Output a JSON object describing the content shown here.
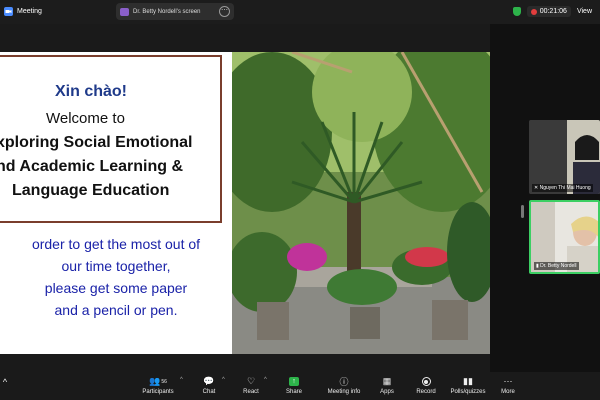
{
  "window": {
    "app_title": "Meeting"
  },
  "share_pill": {
    "label": "Dr. Betty Nordell's screen"
  },
  "top_right": {
    "timer": "00:21:06",
    "view_label": "View"
  },
  "slide": {
    "greeting": "Xin chào!",
    "welcome": "Welcome to",
    "title_line1": "xploring  Social Emotional",
    "title_line2": "nd Academic Learning  &",
    "title_line3": "Language Education",
    "instructions": [
      "order to get the most out of",
      "our time together,",
      "please get some paper",
      "and a pencil or pen."
    ]
  },
  "participants_gallery": [
    {
      "name": "Nguyen Thi Mai Huong"
    },
    {
      "name": "Dr. Betty Nordell"
    }
  ],
  "toolbar": {
    "participants_count": "56",
    "participants_label": "Participants",
    "chat_label": "Chat",
    "react_label": "React",
    "share_label": "Share",
    "meeting_info_label": "Meeting info",
    "apps_label": "Apps",
    "record_label": "Record",
    "polls_label": "Polls/quizzes",
    "more_label": "More"
  },
  "colors": {
    "accent_green": "#2db34a",
    "slide_title_blue": "#1f3a8a",
    "instruction_blue": "#1a22a8",
    "slide_border": "#7a3e2c"
  }
}
